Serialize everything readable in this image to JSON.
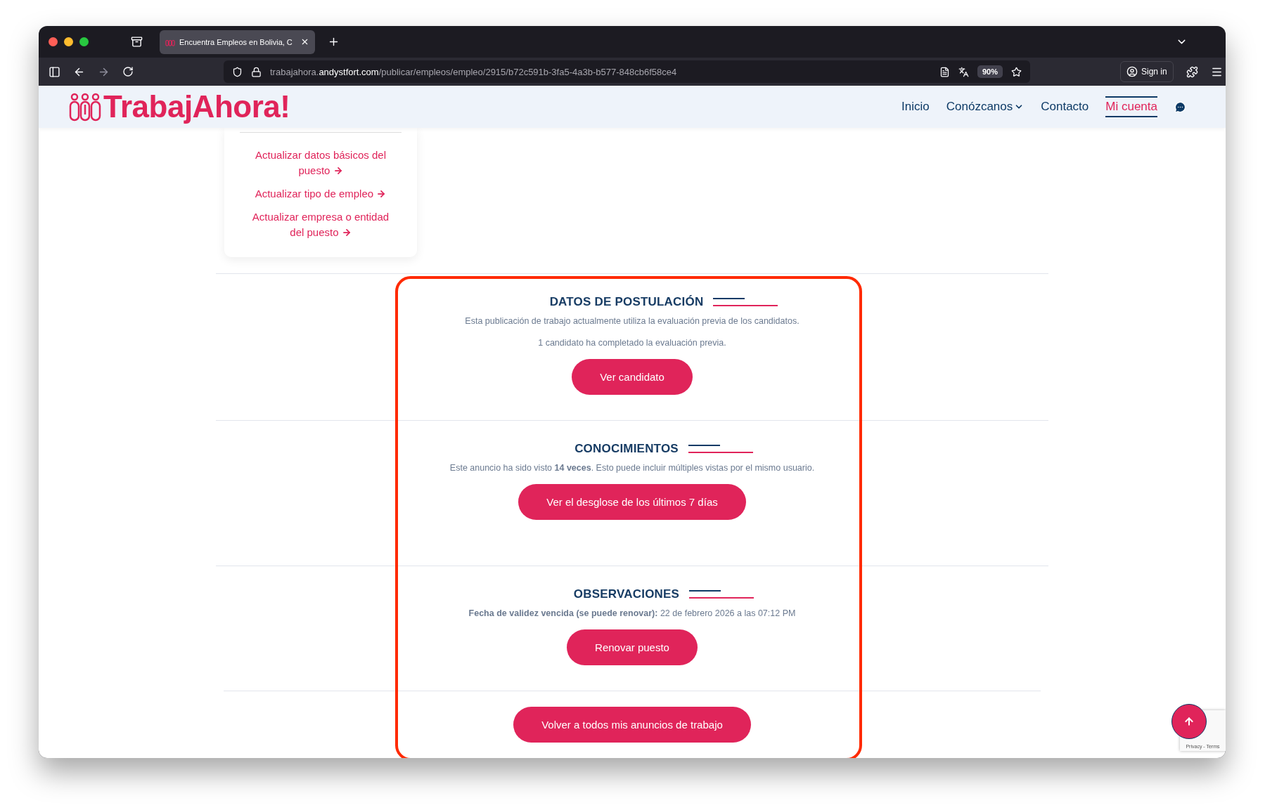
{
  "browser": {
    "tab_title": "Encuentra Empleos en Bolivia, C",
    "url": {
      "subdomain": "trabajahora.",
      "domain": "andystfort.com",
      "path": "/publicar/empleos/empleo/2915/b72c591b-3fa5-4a3b-b577-848cb6f58ce4"
    },
    "zoom": "90%",
    "sign_in": "Sign in"
  },
  "site": {
    "logo": "TrabajAhora!",
    "nav": [
      {
        "label": "Inicio",
        "selected": false,
        "has_menu": false
      },
      {
        "label": "Conózcanos",
        "selected": false,
        "has_menu": true
      },
      {
        "label": "Contacto",
        "selected": false,
        "has_menu": false
      },
      {
        "label": "Mi cuenta",
        "selected": true,
        "has_menu": false
      }
    ]
  },
  "side_links": [
    "Actualizar datos básicos del puesto",
    "Actualizar tipo de empleo",
    "Actualizar empresa o entidad del puesto"
  ],
  "sections": [
    {
      "title": "DATOS DE POSTULACIÓN",
      "paragraphs": [
        "Esta publicación de trabajo actualmente utiliza la evaluación previa de los candidatos.",
        "1 candidato ha completado la evaluación previa."
      ],
      "button": "Ver candidato"
    },
    {
      "title": "CONOCIMIENTOS",
      "paragraphs": [
        "Este anuncio ha sido visto **14 veces**. Esto puede incluir múltiples vistas por el mismo usuario."
      ],
      "button": "Ver el desglose de los últimos 7 días"
    },
    {
      "title": "OBSERVACIONES",
      "paragraphs": [
        "**Fecha de validez vencida (se puede renovar):** 22 de febrero 2026 a las 07:12 PM"
      ],
      "button": "Renovar puesto"
    }
  ],
  "back_button": "Volver a todos mis anuncios de trabajo",
  "recaptcha": "Privacy - Terms"
}
